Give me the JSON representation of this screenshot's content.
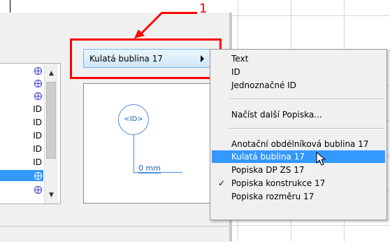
{
  "callout": {
    "number": "1",
    "color": "#ff0000"
  },
  "dropdown": {
    "label": "Kulatá bublina 17"
  },
  "list_items": [
    {
      "icon": "globe-icon",
      "text": ""
    },
    {
      "icon": "globe-icon",
      "text": ""
    },
    {
      "icon": "globe-icon",
      "text": ""
    },
    {
      "icon": null,
      "text": "ID"
    },
    {
      "icon": null,
      "text": "ID"
    },
    {
      "icon": null,
      "text": "ID"
    },
    {
      "icon": null,
      "text": "ID"
    },
    {
      "icon": null,
      "text": "ID"
    },
    {
      "icon": "globe-icon",
      "text": "",
      "selected": true
    },
    {
      "icon": "globe-icon",
      "text": ""
    }
  ],
  "preview": {
    "bubble_text": "<ID>",
    "unit_label": "0 mm"
  },
  "menu": {
    "group1": [
      "Text",
      "ID",
      "Jednoznačné ID"
    ],
    "group2": [
      "Načíst další Popiska..."
    ],
    "group3": [
      {
        "label": "Anotační obdélníková bublina 17"
      },
      {
        "label": "Kulatá bublina 17",
        "highlighted": true
      },
      {
        "label": "Popiska DP ZS 17"
      },
      {
        "label": "Popiska konstrukce 17",
        "checked": true
      },
      {
        "label": "Popiska rozměru 17"
      }
    ]
  },
  "colors": {
    "highlight": "#3399ff",
    "bubble": "#4a8de0",
    "annotation_red": "#ff0000"
  }
}
